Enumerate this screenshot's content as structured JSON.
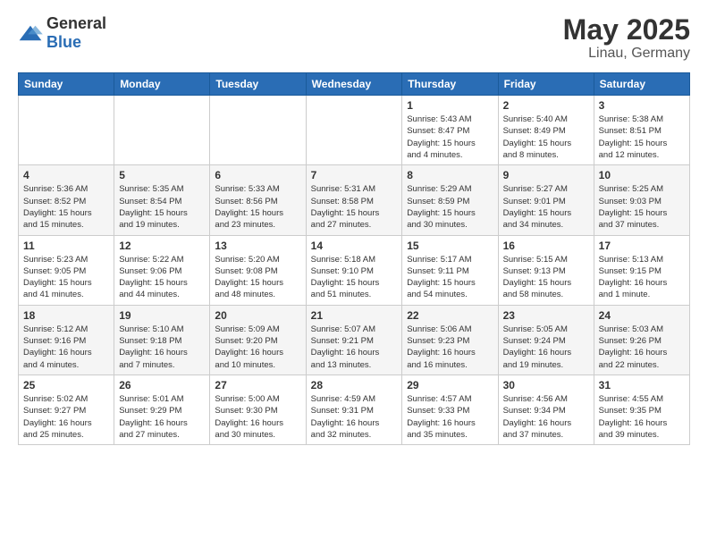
{
  "logo": {
    "general": "General",
    "blue": "Blue"
  },
  "title": "May 2025",
  "subtitle": "Linau, Germany",
  "days_header": [
    "Sunday",
    "Monday",
    "Tuesday",
    "Wednesday",
    "Thursday",
    "Friday",
    "Saturday"
  ],
  "weeks": [
    [
      {
        "day": "",
        "info": ""
      },
      {
        "day": "",
        "info": ""
      },
      {
        "day": "",
        "info": ""
      },
      {
        "day": "",
        "info": ""
      },
      {
        "day": "1",
        "info": "Sunrise: 5:43 AM\nSunset: 8:47 PM\nDaylight: 15 hours\nand 4 minutes."
      },
      {
        "day": "2",
        "info": "Sunrise: 5:40 AM\nSunset: 8:49 PM\nDaylight: 15 hours\nand 8 minutes."
      },
      {
        "day": "3",
        "info": "Sunrise: 5:38 AM\nSunset: 8:51 PM\nDaylight: 15 hours\nand 12 minutes."
      }
    ],
    [
      {
        "day": "4",
        "info": "Sunrise: 5:36 AM\nSunset: 8:52 PM\nDaylight: 15 hours\nand 15 minutes."
      },
      {
        "day": "5",
        "info": "Sunrise: 5:35 AM\nSunset: 8:54 PM\nDaylight: 15 hours\nand 19 minutes."
      },
      {
        "day": "6",
        "info": "Sunrise: 5:33 AM\nSunset: 8:56 PM\nDaylight: 15 hours\nand 23 minutes."
      },
      {
        "day": "7",
        "info": "Sunrise: 5:31 AM\nSunset: 8:58 PM\nDaylight: 15 hours\nand 27 minutes."
      },
      {
        "day": "8",
        "info": "Sunrise: 5:29 AM\nSunset: 8:59 PM\nDaylight: 15 hours\nand 30 minutes."
      },
      {
        "day": "9",
        "info": "Sunrise: 5:27 AM\nSunset: 9:01 PM\nDaylight: 15 hours\nand 34 minutes."
      },
      {
        "day": "10",
        "info": "Sunrise: 5:25 AM\nSunset: 9:03 PM\nDaylight: 15 hours\nand 37 minutes."
      }
    ],
    [
      {
        "day": "11",
        "info": "Sunrise: 5:23 AM\nSunset: 9:05 PM\nDaylight: 15 hours\nand 41 minutes."
      },
      {
        "day": "12",
        "info": "Sunrise: 5:22 AM\nSunset: 9:06 PM\nDaylight: 15 hours\nand 44 minutes."
      },
      {
        "day": "13",
        "info": "Sunrise: 5:20 AM\nSunset: 9:08 PM\nDaylight: 15 hours\nand 48 minutes."
      },
      {
        "day": "14",
        "info": "Sunrise: 5:18 AM\nSunset: 9:10 PM\nDaylight: 15 hours\nand 51 minutes."
      },
      {
        "day": "15",
        "info": "Sunrise: 5:17 AM\nSunset: 9:11 PM\nDaylight: 15 hours\nand 54 minutes."
      },
      {
        "day": "16",
        "info": "Sunrise: 5:15 AM\nSunset: 9:13 PM\nDaylight: 15 hours\nand 58 minutes."
      },
      {
        "day": "17",
        "info": "Sunrise: 5:13 AM\nSunset: 9:15 PM\nDaylight: 16 hours\nand 1 minute."
      }
    ],
    [
      {
        "day": "18",
        "info": "Sunrise: 5:12 AM\nSunset: 9:16 PM\nDaylight: 16 hours\nand 4 minutes."
      },
      {
        "day": "19",
        "info": "Sunrise: 5:10 AM\nSunset: 9:18 PM\nDaylight: 16 hours\nand 7 minutes."
      },
      {
        "day": "20",
        "info": "Sunrise: 5:09 AM\nSunset: 9:20 PM\nDaylight: 16 hours\nand 10 minutes."
      },
      {
        "day": "21",
        "info": "Sunrise: 5:07 AM\nSunset: 9:21 PM\nDaylight: 16 hours\nand 13 minutes."
      },
      {
        "day": "22",
        "info": "Sunrise: 5:06 AM\nSunset: 9:23 PM\nDaylight: 16 hours\nand 16 minutes."
      },
      {
        "day": "23",
        "info": "Sunrise: 5:05 AM\nSunset: 9:24 PM\nDaylight: 16 hours\nand 19 minutes."
      },
      {
        "day": "24",
        "info": "Sunrise: 5:03 AM\nSunset: 9:26 PM\nDaylight: 16 hours\nand 22 minutes."
      }
    ],
    [
      {
        "day": "25",
        "info": "Sunrise: 5:02 AM\nSunset: 9:27 PM\nDaylight: 16 hours\nand 25 minutes."
      },
      {
        "day": "26",
        "info": "Sunrise: 5:01 AM\nSunset: 9:29 PM\nDaylight: 16 hours\nand 27 minutes."
      },
      {
        "day": "27",
        "info": "Sunrise: 5:00 AM\nSunset: 9:30 PM\nDaylight: 16 hours\nand 30 minutes."
      },
      {
        "day": "28",
        "info": "Sunrise: 4:59 AM\nSunset: 9:31 PM\nDaylight: 16 hours\nand 32 minutes."
      },
      {
        "day": "29",
        "info": "Sunrise: 4:57 AM\nSunset: 9:33 PM\nDaylight: 16 hours\nand 35 minutes."
      },
      {
        "day": "30",
        "info": "Sunrise: 4:56 AM\nSunset: 9:34 PM\nDaylight: 16 hours\nand 37 minutes."
      },
      {
        "day": "31",
        "info": "Sunrise: 4:55 AM\nSunset: 9:35 PM\nDaylight: 16 hours\nand 39 minutes."
      }
    ]
  ]
}
